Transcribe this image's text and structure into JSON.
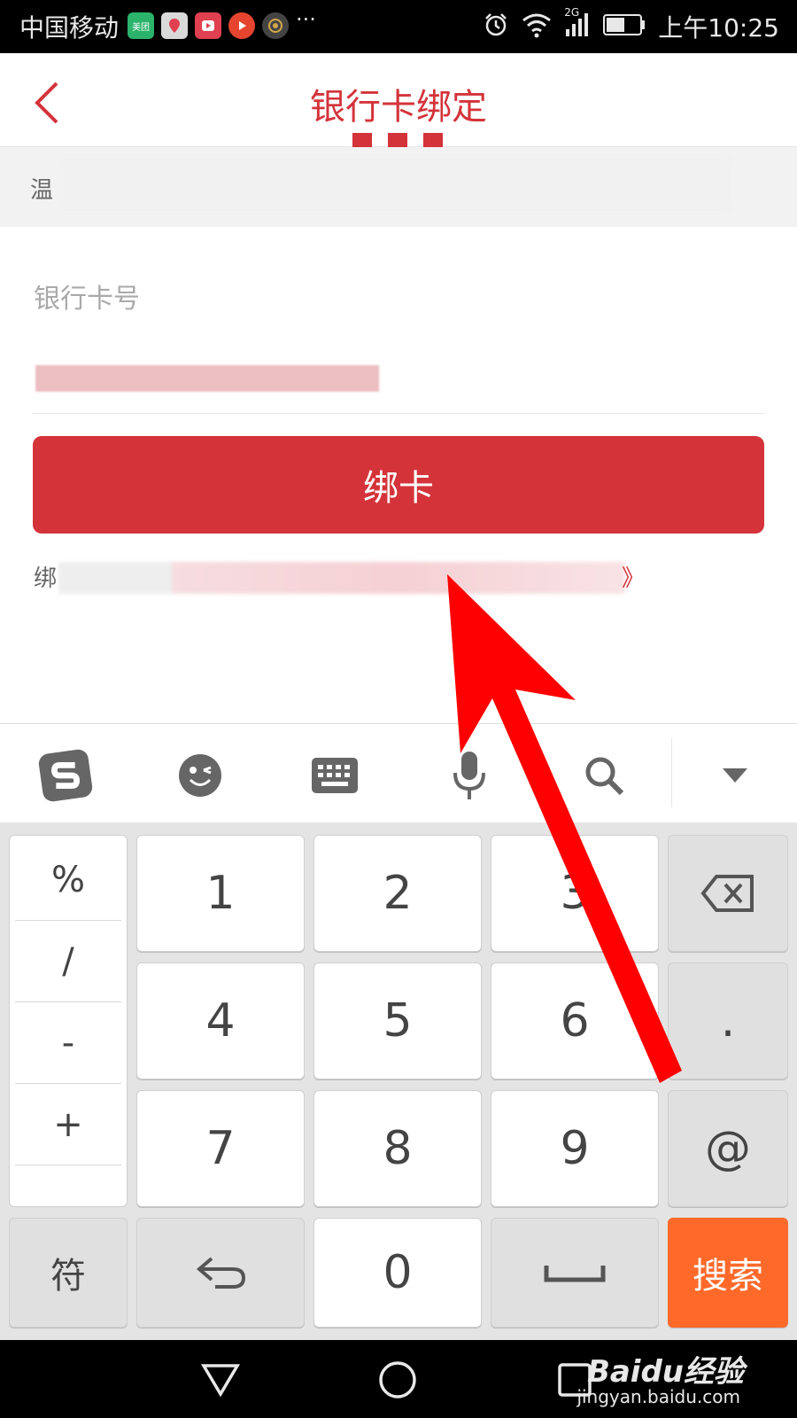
{
  "status_bar": {
    "carrier": "中国移动",
    "app_icons": [
      {
        "name": "meituan-app-icon",
        "label": "美团",
        "color": "#2bb36b"
      },
      {
        "name": "map-app-icon",
        "label": "",
        "color": "#d9d9d9"
      },
      {
        "name": "video-app-icon",
        "label": "",
        "color": "#e04050"
      },
      {
        "name": "media-app-icon",
        "label": "",
        "color": "#e5452f"
      },
      {
        "name": "camera-app-icon",
        "label": "",
        "color": "#444"
      }
    ],
    "more": "···",
    "network": "2G",
    "time": "上午10:25"
  },
  "header": {
    "title": "银行卡绑定",
    "accent_color": "#d4333a"
  },
  "tip": {
    "text": "温"
  },
  "form": {
    "card_label": "银行卡号",
    "card_value": "",
    "bind_button": "绑卡",
    "agreement_prefix": "绑",
    "agreement_suffix": "》"
  },
  "ime_toolbar": {
    "tools": [
      "sogou-logo-icon",
      "emoji-icon",
      "keyboard-icon",
      "microphone-icon",
      "search-icon",
      "collapse-icon"
    ]
  },
  "keyboard": {
    "symbols": [
      "%",
      "/",
      "-",
      "+"
    ],
    "digits": [
      "1",
      "2",
      "3",
      "4",
      "5",
      "6",
      "7",
      "8",
      "9"
    ],
    "dot": ".",
    "at": "@",
    "symbol_key": "符",
    "zero": "0",
    "search_key": "搜索",
    "search_color": "#ff6a2b"
  },
  "watermark": {
    "brand": "Baidu经验",
    "url": "jingyan.baidu.com"
  }
}
